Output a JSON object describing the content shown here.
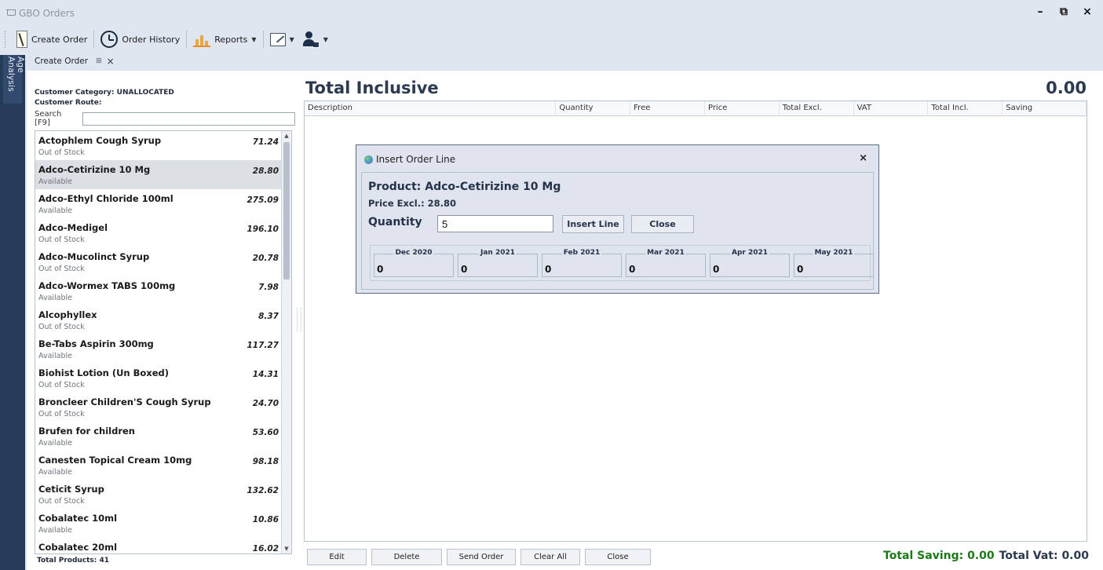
{
  "window": {
    "title": "GBO Orders",
    "controls": [
      "minimize",
      "restore",
      "close"
    ]
  },
  "toolbar": {
    "create_order": "Create Order",
    "order_history": "Order History",
    "reports": "Reports"
  },
  "sidebar": {
    "tab_label": "Age Analysis"
  },
  "document_tab": {
    "label": "Create Order"
  },
  "customer": {
    "category": "Customer Category: UNALLOCATED",
    "route": "Customer Route:"
  },
  "search": {
    "label": "Search [F9]",
    "value": ""
  },
  "products": [
    {
      "name": "Actophlem Cough Syrup",
      "price": "71.24",
      "status": "Out of Stock"
    },
    {
      "name": "Adco-Cetirizine 10 Mg",
      "price": "28.80",
      "status": "Available"
    },
    {
      "name": "Adco-Ethyl Chloride 100ml",
      "price": "275.09",
      "status": "Available"
    },
    {
      "name": "Adco-Medigel",
      "price": "196.10",
      "status": "Out of Stock"
    },
    {
      "name": "Adco-Mucolinct Syrup",
      "price": "20.78",
      "status": "Out of Stock"
    },
    {
      "name": "Adco-Wormex TABS 100mg",
      "price": "7.98",
      "status": "Available"
    },
    {
      "name": "Alcophyllex",
      "price": "8.37",
      "status": "Out of Stock"
    },
    {
      "name": "Be-Tabs Aspirin 300mg",
      "price": "117.27",
      "status": "Available"
    },
    {
      "name": "Biohist Lotion  (Un Boxed)",
      "price": "14.31",
      "status": "Out of Stock"
    },
    {
      "name": "Broncleer Children'S Cough Syrup",
      "price": "24.70",
      "status": "Out of Stock"
    },
    {
      "name": "Brufen for children",
      "price": "53.60",
      "status": "Available"
    },
    {
      "name": "Canesten Topical Cream 10mg",
      "price": "98.18",
      "status": "Available"
    },
    {
      "name": "Ceticit Syrup",
      "price": "132.62",
      "status": "Out of Stock"
    },
    {
      "name": "Cobalatec 10ml",
      "price": "10.86",
      "status": "Available"
    },
    {
      "name": "Cobalatec 20ml",
      "price": "16.02",
      "status": ""
    }
  ],
  "total_products": "Total Products: 41",
  "order": {
    "heading": "Total Inclusive",
    "total": "0.00",
    "columns": [
      "Description",
      "Quantity",
      "Free",
      "Price",
      "Total Excl.",
      "VAT",
      "Total Incl.",
      "Saving"
    ],
    "buttons": [
      "Edit",
      "Delete",
      "Send Order",
      "Clear All",
      "Close"
    ],
    "total_saving": "Total Saving: 0.00",
    "total_vat": "Total Vat: 0.00"
  },
  "dialog": {
    "title": "Insert Order Line",
    "product": "Product: Adco-Cetirizine 10 Mg",
    "price": "Price Excl.: 28.80",
    "quantity_label": "Quantity",
    "quantity_value": "5",
    "insert_button": "Insert Line",
    "close_button": "Close",
    "months": [
      {
        "label": "Dec 2020",
        "value": "0"
      },
      {
        "label": "Jan 2021",
        "value": "0"
      },
      {
        "label": "Feb 2021",
        "value": "0"
      },
      {
        "label": "Mar 2021",
        "value": "0"
      },
      {
        "label": "Apr 2021",
        "value": "0"
      },
      {
        "label": "May 2021",
        "value": "0"
      }
    ]
  }
}
